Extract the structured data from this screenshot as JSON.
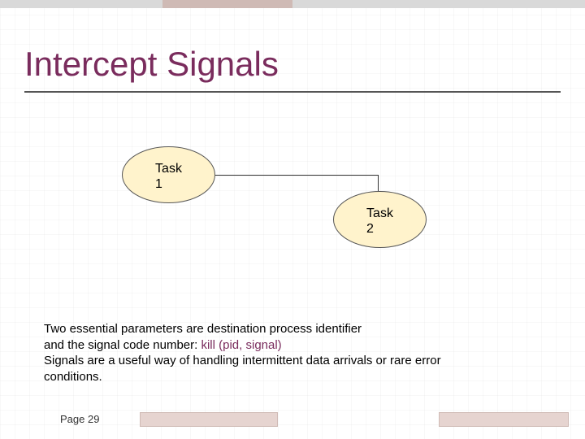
{
  "slide": {
    "title": "Intercept Signals",
    "diagram": {
      "nodes": [
        {
          "id": "task1",
          "label": "Task\n1"
        },
        {
          "id": "task2",
          "label": "Task\n2"
        }
      ]
    },
    "body": {
      "line1": "Two essential parameters are destination process identifier",
      "line2_prefix": "and the signal code number:  ",
      "line2_highlight": "kill (pid, signal)",
      "line3": "Signals are a useful way of handling intermittent data arrivals or rare error",
      "line4": "conditions."
    },
    "footer": {
      "page_label": "Page 29"
    },
    "colors": {
      "accent": "#7a2c5d",
      "oval_fill": "#fff3cc"
    }
  }
}
